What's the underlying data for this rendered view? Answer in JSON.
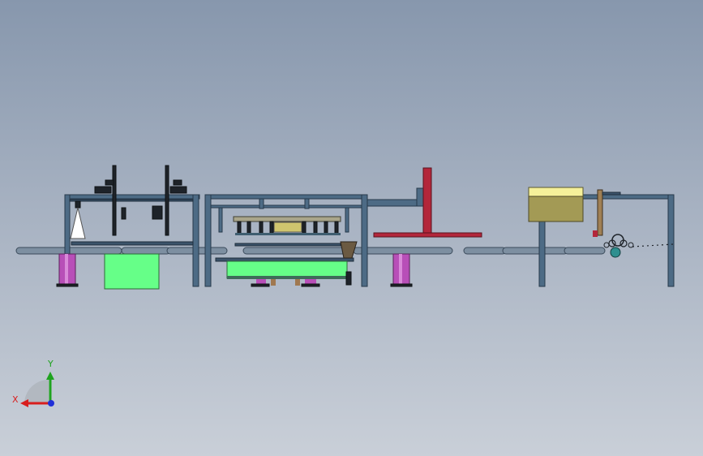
{
  "axis_triad": {
    "x_label": "X",
    "y_label": "Y",
    "x_color": "#d81e1e",
    "y_color": "#1fa31f",
    "z_color": "#1f2fd8"
  },
  "colors": {
    "background_top": "#8797ad",
    "background_bottom": "#c9cfd8",
    "frame": "#4d6b85",
    "green_panel": "#66ff88",
    "magenta_post": "#b84fb8",
    "red_arm": "#b3263a",
    "yellow_box": "#f5f09a",
    "olive_box": "#a39a55"
  }
}
